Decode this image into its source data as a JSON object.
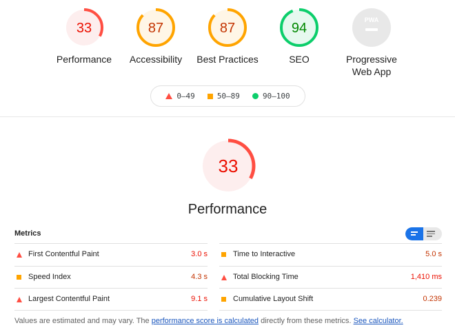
{
  "categories": [
    {
      "score": "33",
      "label": "Performance",
      "fraction": 0.33,
      "status": "fail"
    },
    {
      "score": "87",
      "label": "Accessibility",
      "fraction": 0.87,
      "status": "average"
    },
    {
      "score": "87",
      "label": "Best Practices",
      "fraction": 0.87,
      "status": "average"
    },
    {
      "score": "94",
      "label": "SEO",
      "fraction": 0.94,
      "status": "pass"
    },
    {
      "score": "",
      "label": "Progressive Web App",
      "badge_text": "PWA",
      "status": "na"
    }
  ],
  "legend": {
    "fail": "0–49",
    "average": "50–89",
    "pass": "90–100"
  },
  "colors": {
    "fail": "#ff4e42",
    "fail_bg": "#fdeeee",
    "fail_text": "#eb0f00",
    "average": "#ffa400",
    "average_bg": "#fff6e6",
    "average_text": "#c33300",
    "pass": "#0cce6b",
    "pass_bg": "#e6f9ef",
    "pass_text": "#008800",
    "na": "#cccccc",
    "accent": "#1a73e8"
  },
  "main": {
    "score": "33",
    "fraction": 0.33,
    "title": "Performance"
  },
  "metrics": {
    "title": "Metrics",
    "left": [
      {
        "name": "First Contentful Paint",
        "value": "3.0 s",
        "status": "fail"
      },
      {
        "name": "Speed Index",
        "value": "4.3 s",
        "status": "average"
      },
      {
        "name": "Largest Contentful Paint",
        "value": "9.1 s",
        "status": "fail"
      }
    ],
    "right": [
      {
        "name": "Time to Interactive",
        "value": "5.0 s",
        "status": "average"
      },
      {
        "name": "Total Blocking Time",
        "value": "1,410 ms",
        "status": "fail"
      },
      {
        "name": "Cumulative Layout Shift",
        "value": "0.239",
        "status": "average"
      }
    ]
  },
  "footnote": {
    "prefix": "Values are estimated and may vary. The ",
    "link1": "performance score is calculated",
    "middle": " directly from these metrics. ",
    "link2": "See calculator."
  }
}
